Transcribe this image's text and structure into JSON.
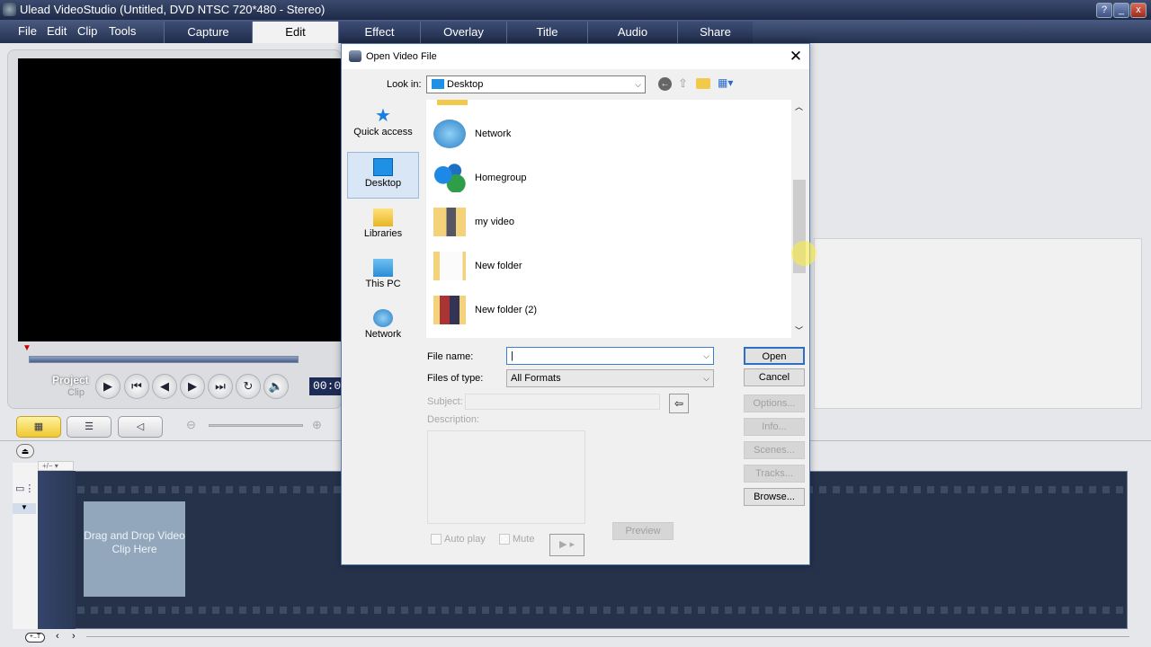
{
  "app": {
    "title": "Ulead VideoStudio (Untitled, DVD NTSC 720*480 - Stereo)",
    "window_buttons": [
      "?",
      "_",
      "x"
    ]
  },
  "menu": [
    "File",
    "Edit",
    "Clip",
    "Tools"
  ],
  "tabs": [
    {
      "label": "Capture"
    },
    {
      "label": "Edit",
      "active": true
    },
    {
      "label": "Effect"
    },
    {
      "label": "Overlay"
    },
    {
      "label": "Title"
    },
    {
      "label": "Audio"
    },
    {
      "label": "Share"
    }
  ],
  "preview": {
    "project_label": "Project",
    "clip_label": "Clip",
    "timecode": "00:0",
    "buttons": [
      "play",
      "home",
      "previous",
      "next",
      "end",
      "repeat",
      "volume"
    ]
  },
  "timeline": {
    "zoom_label": "+/−",
    "dropzone": "Drag and Drop Video Clip Here"
  },
  "dialog": {
    "title": "Open Video File",
    "look_in_label": "Look in:",
    "look_in_value": "Desktop",
    "places": [
      {
        "label": "Quick access",
        "icon": "star-icon"
      },
      {
        "label": "Desktop",
        "icon": "desktop-icon",
        "selected": true
      },
      {
        "label": "Libraries",
        "icon": "libraries-icon"
      },
      {
        "label": "This PC",
        "icon": "computer-icon"
      },
      {
        "label": "Network",
        "icon": "network-icon"
      }
    ],
    "files": [
      {
        "name": "Network",
        "icon": "network-icon"
      },
      {
        "name": "Homegroup",
        "icon": "homegroup-icon"
      },
      {
        "name": "my video",
        "icon": "folder-icon"
      },
      {
        "name": "New folder",
        "icon": "folder-icon"
      },
      {
        "name": "New folder (2)",
        "icon": "folder-icon"
      }
    ],
    "file_name_label": "File name:",
    "file_name_value": "",
    "files_of_type_label": "Files of type:",
    "files_of_type_value": "All Formats",
    "subject_label": "Subject:",
    "description_label": "Description:",
    "autoplay_label": "Auto play",
    "mute_label": "Mute",
    "preview_label": "Preview",
    "buttons": {
      "open": "Open",
      "cancel": "Cancel",
      "options": "Options...",
      "info": "Info...",
      "scenes": "Scenes...",
      "tracks": "Tracks...",
      "browse": "Browse..."
    }
  },
  "colors": {
    "titlebar": "#1e2a48",
    "storyboard": "#26324a",
    "dropzone": "#93a7bc",
    "selection": "#d8e6f5"
  }
}
